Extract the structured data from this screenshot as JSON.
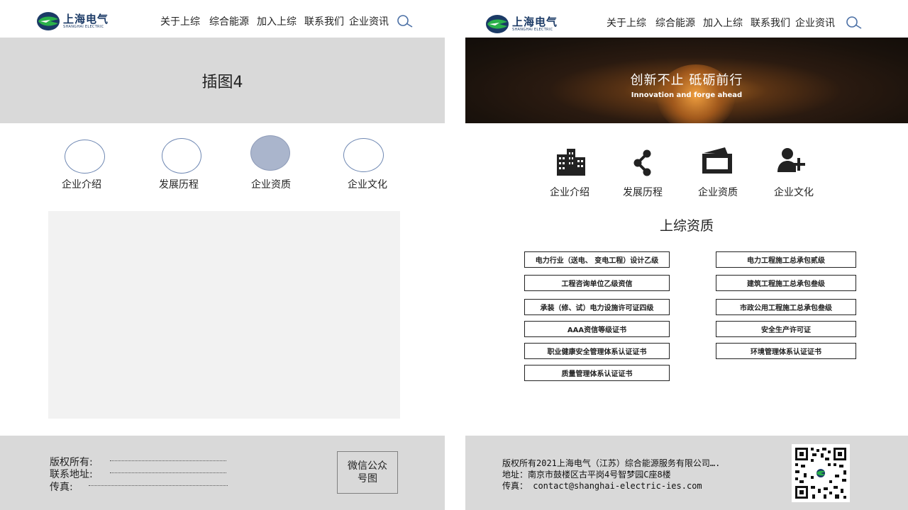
{
  "brand": {
    "name_cn": "上海电气",
    "name_en": "SHANGHAI ELECTRIC",
    "accent": "#1b3a66",
    "logo_green": "#2bb14a"
  },
  "nav": {
    "items": [
      "关于上综",
      "综合能源",
      "加入上综",
      "联系我们",
      "企业资讯"
    ]
  },
  "left": {
    "banner_placeholder": "插图4",
    "icons": [
      {
        "label": "企业介绍"
      },
      {
        "label": "发展历程"
      },
      {
        "label": "企业资质",
        "selected": true
      },
      {
        "label": "企业文化"
      }
    ],
    "footer": {
      "copyright_label": "版权所有:",
      "address_label": "联系地址:",
      "fax_label": "传真:",
      "wechat": "微信公众号图"
    }
  },
  "right": {
    "hero": {
      "title": "创新不止  砥砺前行",
      "subtitle": "Innovation and forge ahead"
    },
    "icons": [
      {
        "label": "企业介绍",
        "icon": "buildings-icon"
      },
      {
        "label": "发展历程",
        "icon": "share-icon"
      },
      {
        "label": "企业资质",
        "icon": "certificate-icon"
      },
      {
        "label": "企业文化",
        "icon": "add-user-icon"
      }
    ],
    "section_title": "上综资质",
    "qualifications_left": [
      "电力行业（送电、 变电工程）设计乙级",
      "工程咨询单位乙级资信",
      "承装（修、试）电力设施许可证四级",
      "AAA资信等级证书",
      "职业健康安全管理体系认证证书",
      "质量管理体系认证证书"
    ],
    "qualifications_right": [
      "电力工程施工总承包贰级",
      "建筑工程施工总承包叁级",
      "市政公用工程施工总承包叁级",
      "安全生产许可证",
      "环境管理体系认证证书"
    ],
    "footer": {
      "copyright": "版权所有2021上海电气（江苏）综合能源服务有限公司….",
      "address": "地址：南京市鼓楼区古平岗4号智梦园C座8楼",
      "fax": "传真：  contact@shanghai-electric-ies.com"
    }
  }
}
